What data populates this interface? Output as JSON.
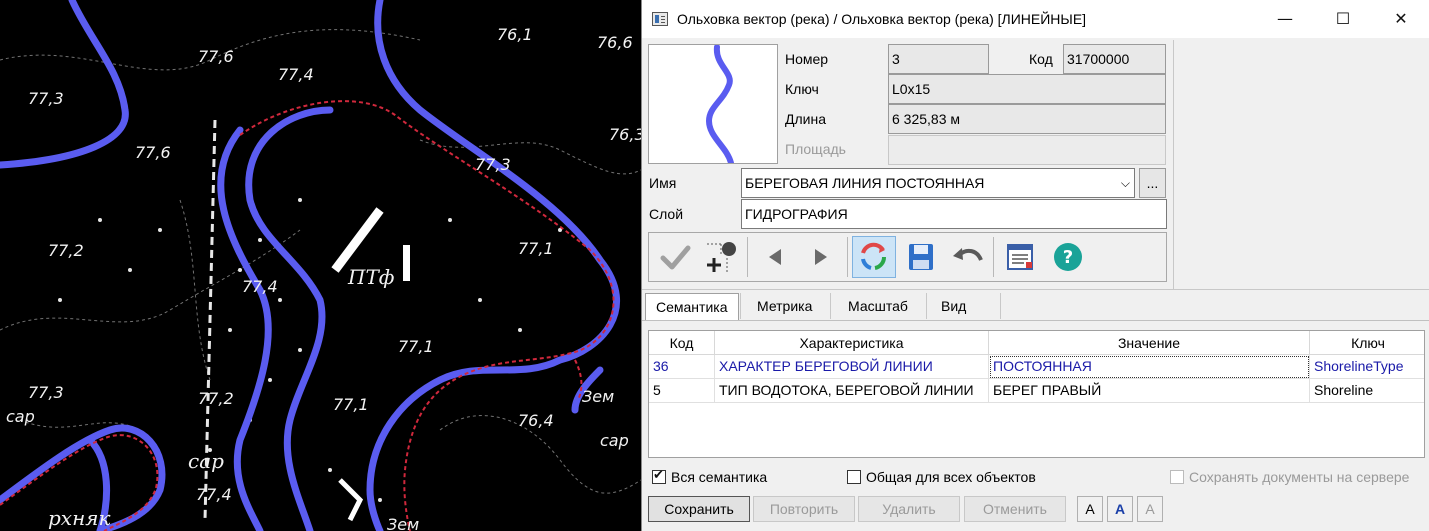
{
  "map": {
    "labels": [
      "76,1",
      "76,6",
      "77,6",
      "77,4",
      "77,3",
      "76,3",
      "77,6",
      "77,3",
      "77,2",
      "77,1",
      "ПТф",
      "77,4",
      "77,1",
      "77,3",
      "77,2",
      "77,1",
      "сар",
      "76,4",
      "сар",
      "сар",
      "77,4",
      "рхняк",
      "Зем",
      "Зем"
    ]
  },
  "window": {
    "title": "Ольховка вектор (река) / Ольховка вектор (река) [ЛИНЕЙНЫЕ]",
    "controls": {
      "minimize": "—",
      "maximize": "☐",
      "close": "✕"
    }
  },
  "info": {
    "number_label": "Номер",
    "number_value": "3",
    "code_label": "Код",
    "code_value": "31700000",
    "key_label": "Ключ",
    "key_value": "L0x15",
    "length_label": "Длина",
    "length_value": "6 325,83 м",
    "area_label": "Площадь",
    "area_value": "",
    "name_label": "Имя",
    "name_value": "БЕРЕГОВАЯ ЛИНИЯ ПОСТОЯННАЯ",
    "name_more": "...",
    "layer_label": "Слой",
    "layer_value": "ГИДРОГРАФИЯ"
  },
  "toolbar": {
    "icons": [
      "checkmark-icon",
      "add-point-icon",
      "arrow-left-icon",
      "arrow-right-icon",
      "refresh-icon",
      "save-icon",
      "undo-icon",
      "properties-window-icon",
      "help-icon"
    ]
  },
  "tabs": [
    "Семантика",
    "Метрика",
    "Масштаб",
    "Вид"
  ],
  "table": {
    "headers": [
      "Код",
      "Характеристика",
      "Значение",
      "Ключ"
    ],
    "rows": [
      {
        "code": "36",
        "name": "ХАРАКТЕР БЕРЕГОВОЙ ЛИНИИ",
        "value": "ПОСТОЯННАЯ",
        "key": "ShorelineType"
      },
      {
        "code": "5",
        "name": "ТИП ВОДОТОКА, БЕРЕГОВОЙ ЛИНИИ",
        "value": "БЕРЕГ ПРАВЫЙ",
        "key": "Shoreline"
      }
    ]
  },
  "options": {
    "all_semantics": "Вся семантика",
    "common_for_all": "Общая для всех объектов",
    "save_docs": "Сохранять документы на сервере"
  },
  "buttons": {
    "save": "Сохранить",
    "repeat": "Повторить",
    "delete": "Удалить",
    "cancel": "Отменить",
    "font_a1": "A",
    "font_a2": "A",
    "font_a3": "A"
  },
  "colors": {
    "river": "#5a5cf0",
    "accent": "#0078d7",
    "help": "#1aa398"
  }
}
